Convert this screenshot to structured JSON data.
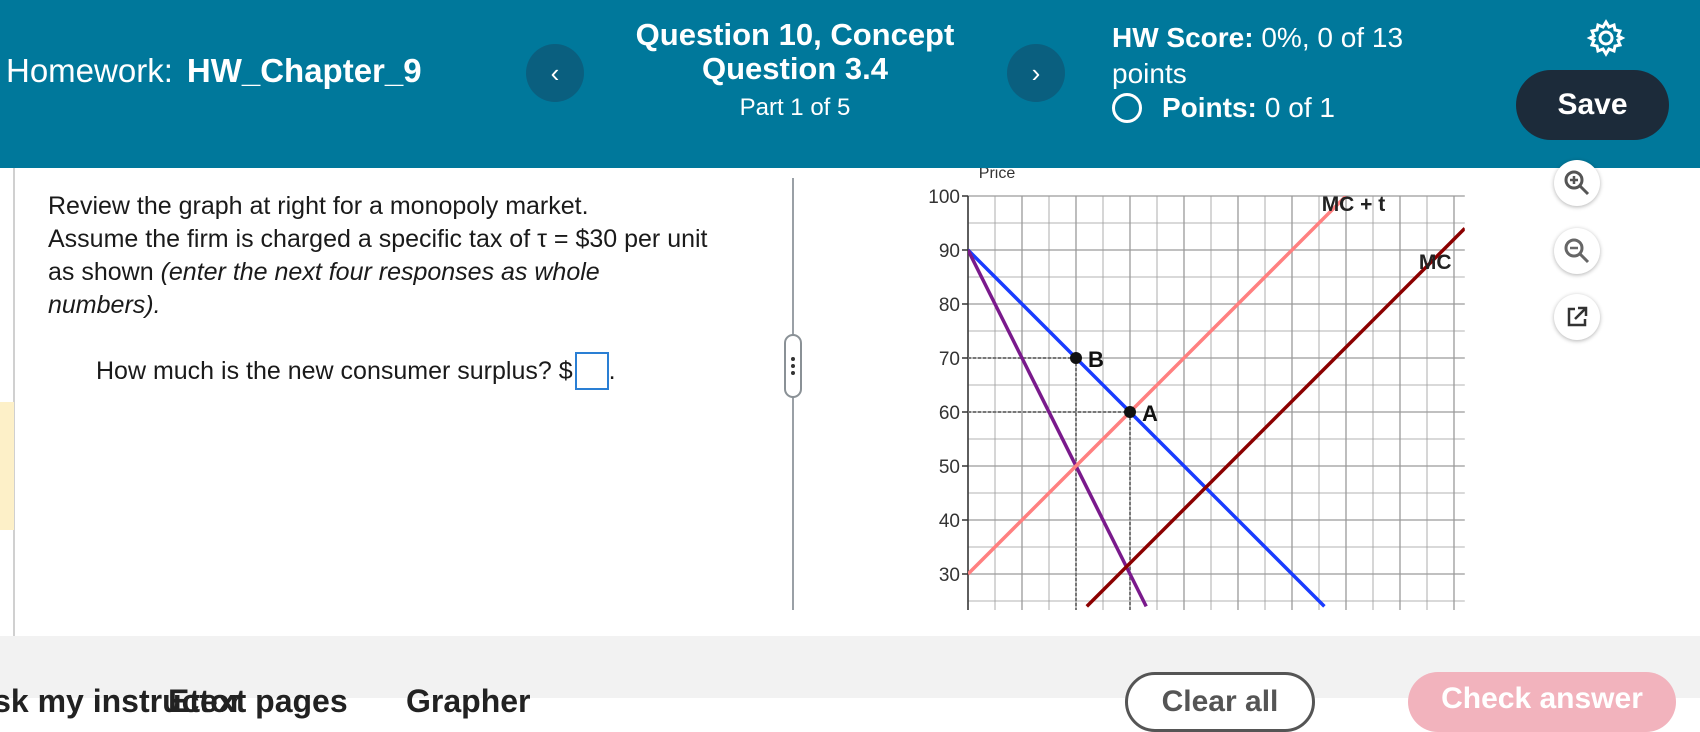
{
  "header": {
    "homework_label": "Homework:",
    "homework_name": "HW_Chapter_9",
    "prev_icon": "chevron-left-icon",
    "prev_glyph": "‹",
    "next_icon": "chevron-right-icon",
    "next_glyph": "›",
    "question_title": "Question 10, Concept Question 3.4",
    "part": "Part 1 of 5",
    "score_label": "HW Score:",
    "score_value": "0%, 0 of 13 points",
    "points_label": "Points:",
    "points_value": "0 of 1",
    "settings_icon": "gear-icon",
    "save_label": "Save",
    "bg_color": "#00789b",
    "save_color": "#1c2b3a"
  },
  "question": {
    "line1": "Review the graph at right for a monopoly market.",
    "line2": "Assume the firm is charged a specific tax of τ = $30 per unit",
    "line3_plain": "as shown ",
    "line3_italic": "(enter the next four responses as whole",
    "line4_italic": "numbers).",
    "prompt": "How much is the new consumer surplus? $",
    "prompt_end": ".",
    "answer_value": ""
  },
  "graph": {
    "top_label": "Price",
    "y_ticks": [
      "100",
      "90",
      "80",
      "70",
      "60",
      "50",
      "40",
      "30"
    ],
    "curve_labels": {
      "mc_t": "MC + t",
      "mc": "MC"
    },
    "point_labels": {
      "a": "A",
      "b": "B"
    },
    "colors": {
      "demand": "#1a3cff",
      "mr": "#7a1a8c",
      "mc": "#8b0000",
      "mc_t": "#ff8080"
    }
  },
  "chart_data": {
    "type": "line",
    "ylabel": "Price",
    "ylim": [
      25,
      100
    ],
    "x_major_step": 10,
    "grid": true,
    "series": [
      {
        "name": "",
        "color": "#1a3cff",
        "x": [
          0,
          66
        ],
        "y": [
          90,
          24
        ]
      },
      {
        "name": "",
        "color": "#7a1a8c",
        "x": [
          0,
          33
        ],
        "y": [
          90,
          24
        ]
      },
      {
        "name": "MC + t",
        "color": "#ff8080",
        "x": [
          0,
          70
        ],
        "y": [
          30,
          100
        ]
      },
      {
        "name": "MC",
        "color": "#8b0000",
        "x": [
          22,
          92
        ],
        "y": [
          24,
          94
        ]
      }
    ],
    "points": [
      {
        "label": "B",
        "x": 20,
        "y": 70
      },
      {
        "label": "A",
        "x": 30,
        "y": 60
      }
    ]
  },
  "tools": {
    "zoom_in_icon": "zoom-in-icon",
    "zoom_out_icon": "zoom-out-icon",
    "popout_icon": "popout-icon"
  },
  "footer": {
    "link1": "Ask my instructor",
    "link2": "Etext pages",
    "link3": "Grapher",
    "clear_label": "Clear all",
    "check_label": "Check answer"
  }
}
